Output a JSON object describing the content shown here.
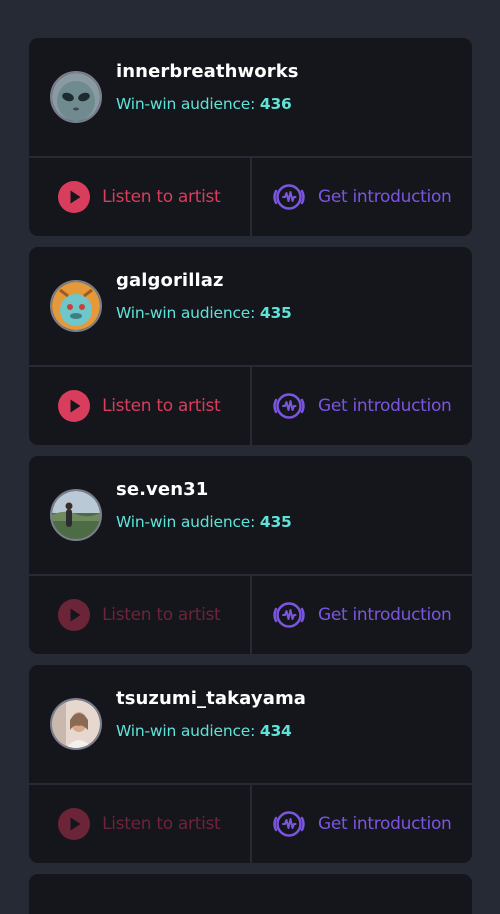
{
  "audience_label": "Win-win audience:",
  "listen_label": "Listen to artist",
  "intro_label": "Get introduction",
  "colors": {
    "background": "#262a35",
    "card": "#15161b",
    "audience_text": "#5fe3d8",
    "listen_active": "#d93d5e",
    "listen_disabled": "#6b2438",
    "intro": "#7a56e0"
  },
  "artists": [
    {
      "name": "innerbreathworks",
      "audience": "436",
      "listen_enabled": true,
      "avatar_icon": "alien-face-avatar"
    },
    {
      "name": "galgorillaz",
      "audience": "435",
      "listen_enabled": true,
      "avatar_icon": "gorilla-art-avatar"
    },
    {
      "name": "se.ven31",
      "audience": "435",
      "listen_enabled": false,
      "avatar_icon": "landscape-photo-avatar"
    },
    {
      "name": "tsuzumi_takayama",
      "audience": "434",
      "listen_enabled": false,
      "avatar_icon": "portrait-photo-avatar"
    }
  ]
}
